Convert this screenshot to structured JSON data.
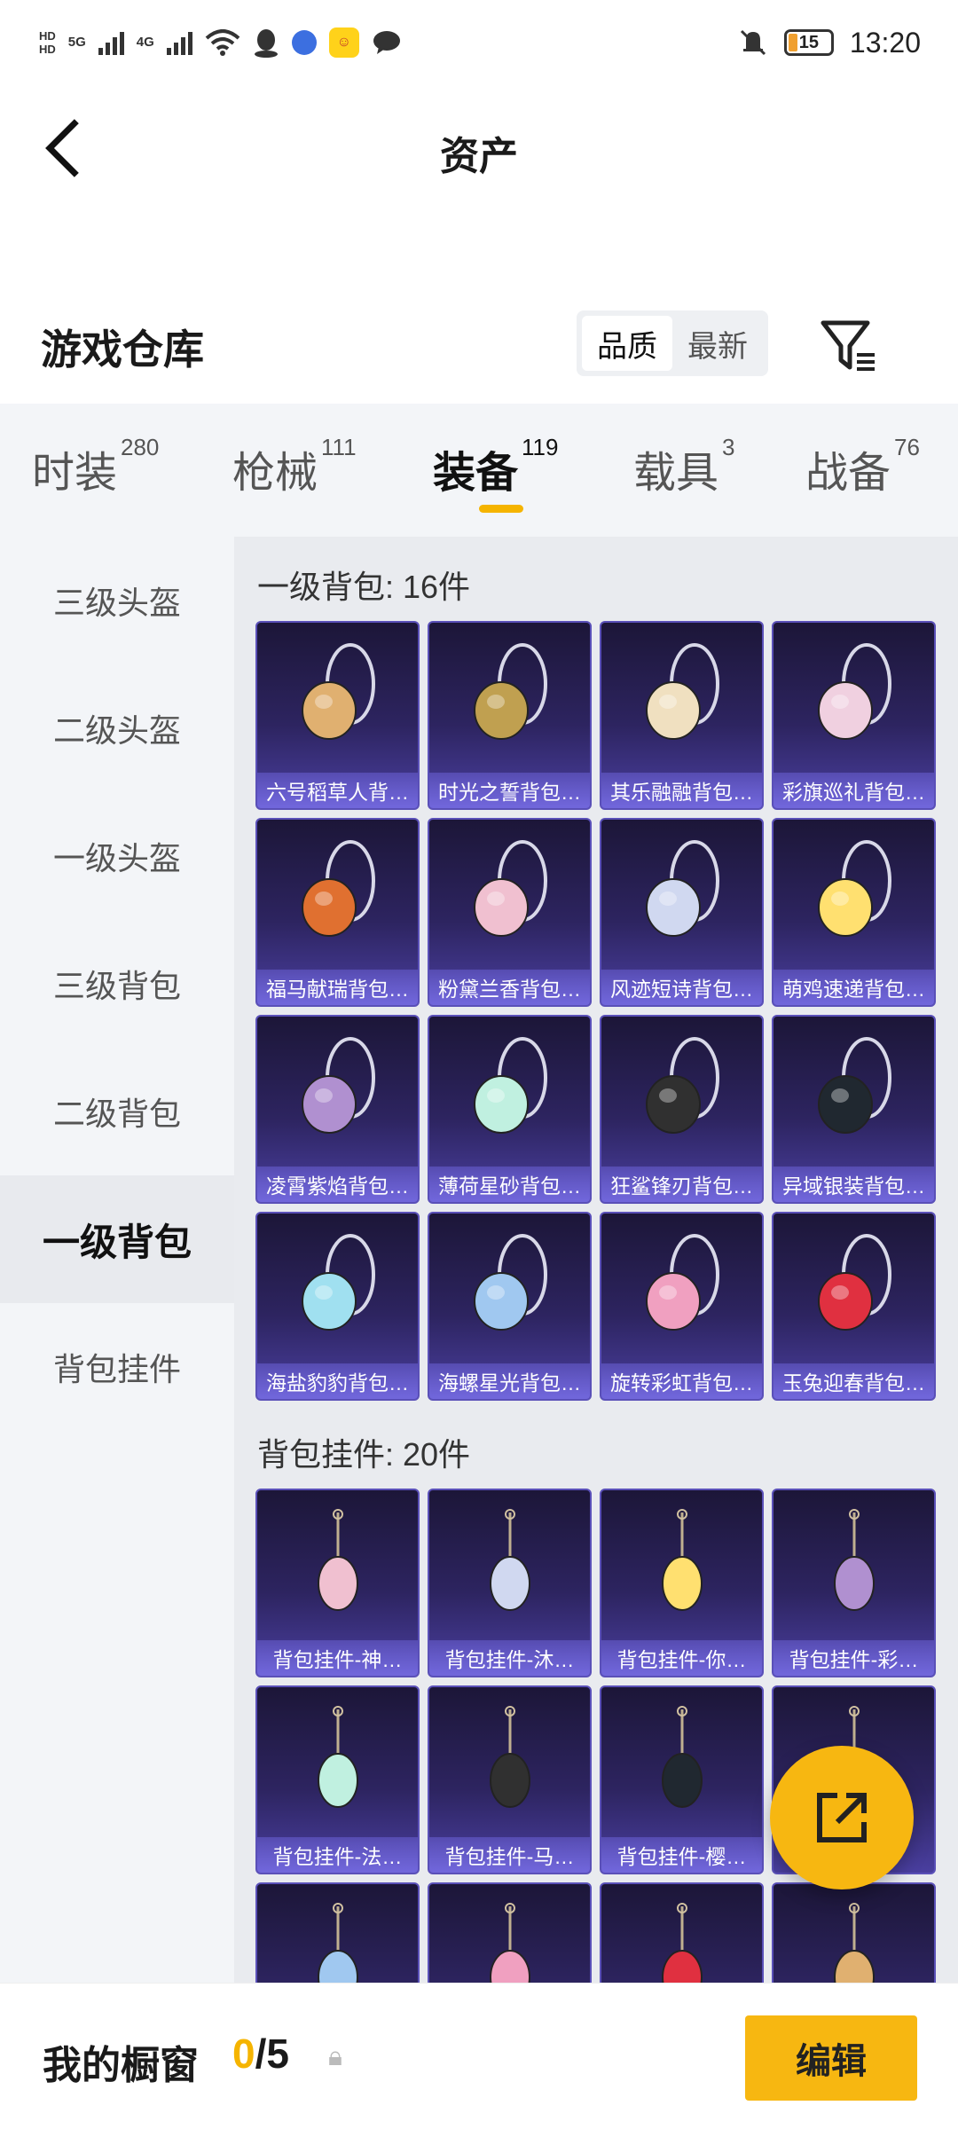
{
  "status": {
    "hd_top": "HD",
    "hd_bottom": "HD",
    "net1": "5G",
    "net2": "4G",
    "battery": "15",
    "time": "13:20"
  },
  "nav": {
    "title": "资产"
  },
  "header": {
    "title": "游戏仓库",
    "sort_options": [
      "品质",
      "最新"
    ],
    "sort_selected": "品质"
  },
  "categories": [
    {
      "label": "时装",
      "count": "280"
    },
    {
      "label": "枪械",
      "count": "111"
    },
    {
      "label": "装备",
      "count": "119"
    },
    {
      "label": "载具",
      "count": "3"
    },
    {
      "label": "战备",
      "count": "76"
    }
  ],
  "active_category": "装备",
  "sidebar": {
    "items": [
      "三级头盔",
      "二级头盔",
      "一级头盔",
      "三级背包",
      "二级背包",
      "一级背包",
      "背包挂件"
    ],
    "selected": "一级背包"
  },
  "sections": [
    {
      "title": "一级背包: 16件",
      "items": [
        "六号稻草人背…",
        "时光之誓背包…",
        "其乐融融背包…",
        "彩旗巡礼背包…",
        "福马献瑞背包…",
        "粉黛兰香背包…",
        "风迹短诗背包…",
        "萌鸡速递背包…",
        "凌霄紫焰背包…",
        "薄荷星砂背包…",
        "狂鲨锋刃背包…",
        "异域银装背包…",
        "海盐豹豹背包…",
        "海螺星光背包…",
        "旋转彩虹背包…",
        "玉兔迎春背包…"
      ]
    },
    {
      "title": "背包挂件: 20件",
      "items": [
        "背包挂件-神…",
        "背包挂件-沐…",
        "背包挂件-你…",
        "背包挂件-彩…",
        "背包挂件-法…",
        "背包挂件-马…",
        "背包挂件-樱…",
        "",
        "",
        "",
        "",
        ""
      ]
    }
  ],
  "bottom": {
    "title": "我的橱窗",
    "count_current": "0",
    "count_sep": "/",
    "count_total": "5",
    "edit_label": "编辑"
  },
  "colors": {
    "accent": "#f7b711",
    "card_bg": "#2d2460"
  }
}
